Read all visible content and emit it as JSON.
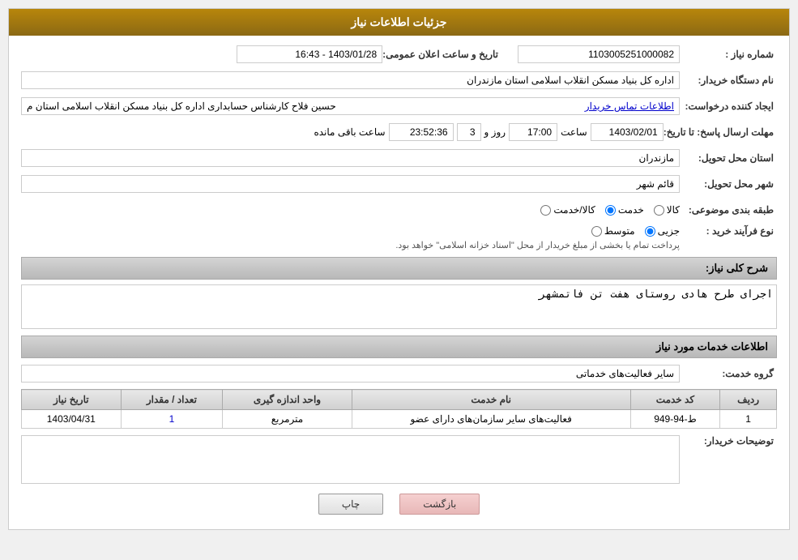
{
  "header": {
    "title": "جزئیات اطلاعات نیاز"
  },
  "fields": {
    "need_number_label": "شماره نیاز :",
    "need_number_value": "1103005251000082",
    "announcement_date_label": "تاریخ و ساعت اعلان عمومی:",
    "announcement_date_value": "1403/01/28 - 16:43",
    "buyer_org_label": "نام دستگاه خریدار:",
    "buyer_org_value": "اداره کل بنیاد مسکن انقلاب اسلامی استان مازندران",
    "creator_label": "ایجاد کننده درخواست:",
    "creator_name": "حسین فلاح کارشناس حسابداری اداره کل بنیاد مسکن انقلاب اسلامی استان م",
    "creator_link": "اطلاعات تماس خریدار",
    "deadline_label": "مهلت ارسال پاسخ: تا تاریخ:",
    "deadline_date": "1403/02/01",
    "deadline_time_label": "ساعت",
    "deadline_time": "17:00",
    "deadline_day_label": "روز و",
    "deadline_days": "3",
    "deadline_remaining_label": "ساعت باقی مانده",
    "deadline_remaining": "23:52:36",
    "province_label": "استان محل تحویل:",
    "province_value": "مازندران",
    "city_label": "شهر محل تحویل:",
    "city_value": "قائم شهر",
    "category_label": "طبقه بندی موضوعی:",
    "category_kala": "کالا",
    "category_khadamat": "خدمت",
    "category_kala_khadamat": "کالا/خدمت",
    "category_selected": "khadamat",
    "process_label": "نوع فرآیند خرید :",
    "process_jozei": "جزیی",
    "process_motavaset": "متوسط",
    "process_note": "پرداخت تمام یا بخشی از مبلغ خریدار از محل \"اسناد خزانه اسلامی\" خواهد بود.",
    "description_label": "شرح کلی نیاز:",
    "description_value": "اجرای طرح هادی روستای هفت تن فاتمشهر",
    "services_section": "اطلاعات خدمات مورد نیاز",
    "service_group_label": "گروه خدمت:",
    "service_group_value": "سایر فعالیت‌های خدماتی",
    "table": {
      "headers": [
        "ردیف",
        "کد خدمت",
        "نام خدمت",
        "واحد اندازه گیری",
        "تعداد / مقدار",
        "تاریخ نیاز"
      ],
      "rows": [
        {
          "row": "1",
          "code": "ط-94-949",
          "name": "فعالیت‌های سایر سازمان‌های دارای عضو",
          "unit": "مترمربع",
          "quantity": "1",
          "date": "1403/04/31"
        }
      ]
    },
    "buyer_notes_label": "توضیحات خریدار:",
    "buyer_notes_value": ""
  },
  "buttons": {
    "print": "چاپ",
    "back": "بازگشت"
  }
}
